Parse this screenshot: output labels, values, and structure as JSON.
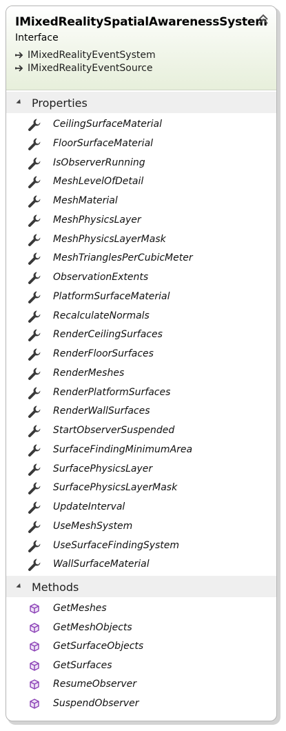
{
  "header": {
    "title": "IMixedRealitySpatialAwarenessSystem",
    "subtitle": "Interface",
    "inherits": [
      "IMixedRealityEventSystem",
      "IMixedRealityEventSource"
    ]
  },
  "sections": {
    "properties": {
      "label": "Properties",
      "icon": "wrench-icon",
      "items": [
        "CeilingSurfaceMaterial",
        "FloorSurfaceMaterial",
        "IsObserverRunning",
        "MeshLevelOfDetail",
        "MeshMaterial",
        "MeshPhysicsLayer",
        "MeshPhysicsLayerMask",
        "MeshTrianglesPerCubicMeter",
        "ObservationExtents",
        "PlatformSurfaceMaterial",
        "RecalculateNormals",
        "RenderCeilingSurfaces",
        "RenderFloorSurfaces",
        "RenderMeshes",
        "RenderPlatformSurfaces",
        "RenderWallSurfaces",
        "StartObserverSuspended",
        "SurfaceFindingMinimumArea",
        "SurfacePhysicsLayer",
        "SurfacePhysicsLayerMask",
        "UpdateInterval",
        "UseMeshSystem",
        "UseSurfaceFindingSystem",
        "WallSurfaceMaterial"
      ]
    },
    "methods": {
      "label": "Methods",
      "icon": "method-cube-icon",
      "items": [
        "GetMeshes",
        "GetMeshObjects",
        "GetSurfaceObjects",
        "GetSurfaces",
        "ResumeObserver",
        "SuspendObserver"
      ]
    }
  },
  "colors": {
    "header_gradient_end": "#e7efdb",
    "section_bg": "#efefef",
    "wrench": "#3a3a3a",
    "method_cube": "#8a3fb5"
  }
}
